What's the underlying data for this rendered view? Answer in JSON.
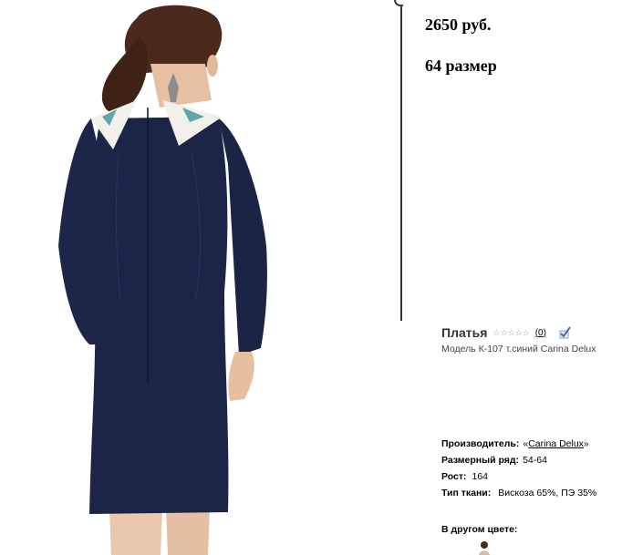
{
  "price": "2650 руб.",
  "size_label": "64 размер",
  "product": {
    "category": "Платья",
    "stars": "☆☆☆☆☆",
    "rating_count": "(0)",
    "model": "Модель К-107 т.синий Carina Delux"
  },
  "specs": {
    "manufacturer_label": "Производитель:",
    "manufacturer_open": "«",
    "manufacturer_value": "Carina Delux",
    "manufacturer_close": "»",
    "size_range_label": "Размерный ряд:",
    "size_range_value": "54-64",
    "height_label": "Рост:",
    "height_value": "164",
    "fabric_label": "Тип ткани:",
    "fabric_value": "Вискоза 65%, ПЭ 35%"
  },
  "other_colors_label": "В другом цвете:",
  "colors": {
    "dress": "#1c2547",
    "collar": "#f1f0ea",
    "accent": "#5fa6a8",
    "hair": "#4b2a1c",
    "skin": "#e8c3a6",
    "panel_border": "#3a3a3a"
  },
  "icons": {
    "stars": "star-outline-icon",
    "compare": "compare-checkmark-icon"
  }
}
